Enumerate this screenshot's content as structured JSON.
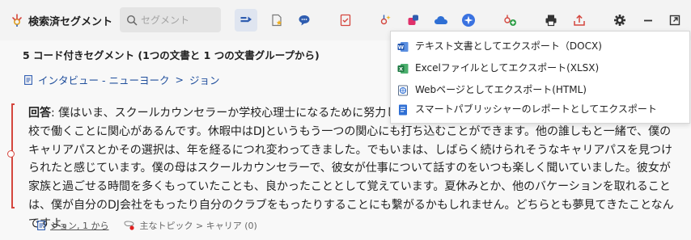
{
  "app": {
    "title": "検索済セグメント"
  },
  "search": {
    "placeholder": "セグメント"
  },
  "toolbar": {
    "icons": [
      "document-icon",
      "comment-icon",
      "print-icon",
      "export-icon",
      "settings-icon",
      "minimize-icon",
      "popout-icon"
    ],
    "accent_color": "#2f5db0"
  },
  "summary": {
    "text": "5 コード付きセグメント (1つの文書と 1 つの文書グループから)"
  },
  "breadcrumb": {
    "path": "インタビュー - ニューヨーク",
    "separator": ">",
    "document": "ジョン"
  },
  "segment": {
    "speaker": "回答",
    "colon": ": ",
    "text": "僕はいま、スクールカウンセラーか学校心理士になるために努力しています。僕の趣味を仕事にできるとい う面でも、学校で働くことに関心があるんです。休暇中はDJというもう一つの関心にも打ち込むことができます。他の誰しもと一緒で、僕のキャリアパスとかその選択は、年を経るにつれ変わってきました。でもいまは、しばらく続けられそうなキャリアパスを見つけられたと感じています。僕の母はスクールカウンセラーで、彼女が仕事について話すのをいつも楽しく聞いていました。彼女が家族と過ごせる時間を多くもっていたことも、良かったこととして覚えています。夏休みとか、他のバケーションを取れることは、僕が自分のDJ会社をもったり自分のクラブをもったりすることにも繫がるかもしれません。どちらとも夢見てきたことなんですよ。",
    "marker_color": "#d4463e"
  },
  "footer": {
    "source": "ジョン, 1 から",
    "code": "主なトピック > キャリア (0)",
    "code_color": "#e02020"
  },
  "export_menu": {
    "items": [
      {
        "label": "テキスト文書としてエクスポート（DOCX)",
        "icon": "word-icon"
      },
      {
        "label": "Excelファイルとしてエクスポート(XLSX)",
        "icon": "excel-icon"
      },
      {
        "label": "Webページとしてエクスポート(HTML)",
        "icon": "web-icon"
      },
      {
        "label": "スマートパブリッシャーのレポートとしてエクスポート",
        "icon": "report-icon"
      }
    ]
  }
}
